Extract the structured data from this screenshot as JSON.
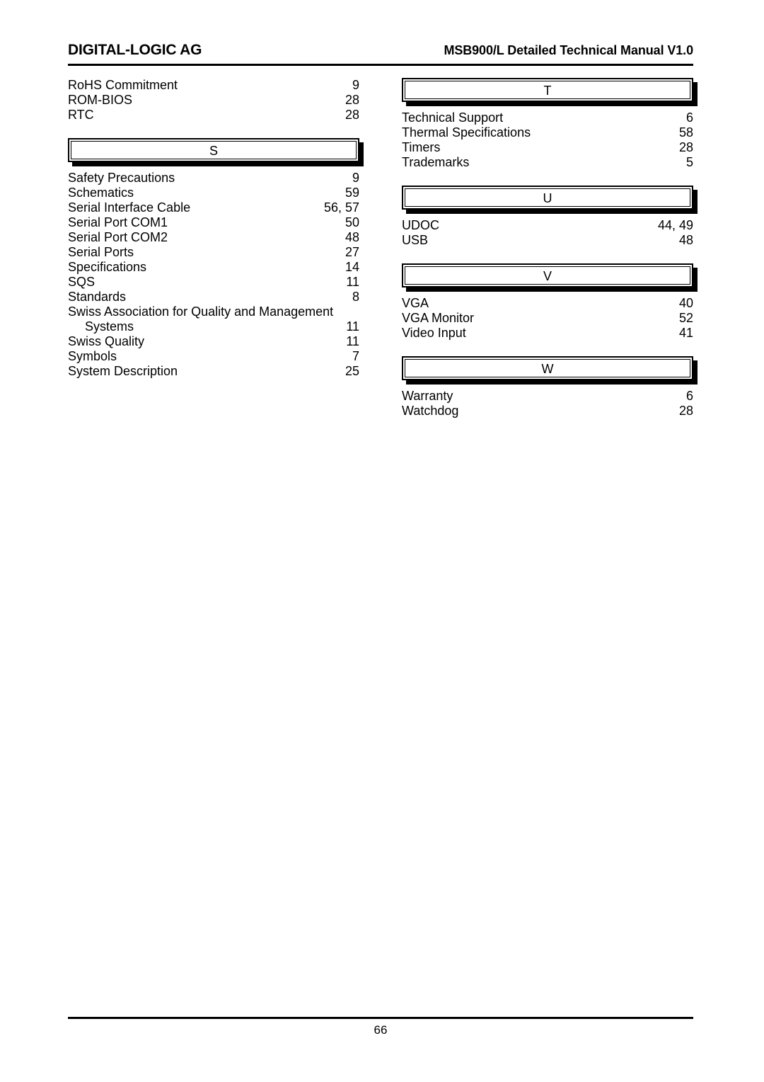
{
  "header": {
    "left_title": "DIGITAL-LOGIC AG",
    "right_title": "MSB900/L Detailed Technical Manual V1.0"
  },
  "footer": {
    "page_number": "66"
  },
  "columns": {
    "left": [
      {
        "kind": "entries",
        "entries": [
          {
            "term": "RoHS Commitment",
            "pages": "9",
            "indent": false
          },
          {
            "term": "ROM-BIOS",
            "pages": "28",
            "indent": false
          },
          {
            "term": "RTC",
            "pages": "28",
            "indent": false
          }
        ]
      },
      {
        "kind": "letter",
        "letter": "S"
      },
      {
        "kind": "entries",
        "entries": [
          {
            "term": "Safety Precautions",
            "pages": "9",
            "indent": false
          },
          {
            "term": "Schematics",
            "pages": "59",
            "indent": false
          },
          {
            "term": "Serial Interface Cable",
            "pages": "56, 57",
            "indent": false
          },
          {
            "term": "Serial Port COM1",
            "pages": "50",
            "indent": false
          },
          {
            "term": "Serial Port COM2",
            "pages": "48",
            "indent": false
          },
          {
            "term": "Serial Ports",
            "pages": "27",
            "indent": false
          },
          {
            "term": "Specifications",
            "pages": "14",
            "indent": false
          },
          {
            "term": "SQS",
            "pages": "11",
            "indent": false
          },
          {
            "term": "Standards",
            "pages": "8",
            "indent": false
          },
          {
            "term": "Swiss Association for Quality and Management",
            "pages": "",
            "indent": false,
            "wrap_head": true
          },
          {
            "term": "Systems",
            "pages": "11",
            "indent": true
          },
          {
            "term": "Swiss Quality",
            "pages": "11",
            "indent": false
          },
          {
            "term": "Symbols",
            "pages": "7",
            "indent": false
          },
          {
            "term": "System Description",
            "pages": "25",
            "indent": false
          }
        ]
      }
    ],
    "right": [
      {
        "kind": "letter",
        "letter": "T",
        "first": true
      },
      {
        "kind": "entries",
        "entries": [
          {
            "term": "Technical Support",
            "pages": "6",
            "indent": false
          },
          {
            "term": "Thermal Specifications",
            "pages": "58",
            "indent": false
          },
          {
            "term": "Timers",
            "pages": "28",
            "indent": false
          },
          {
            "term": "Trademarks",
            "pages": "5",
            "indent": false
          }
        ]
      },
      {
        "kind": "letter",
        "letter": "U"
      },
      {
        "kind": "entries",
        "entries": [
          {
            "term": "UDOC",
            "pages": "44, 49",
            "indent": false
          },
          {
            "term": "USB",
            "pages": "48",
            "indent": false
          }
        ]
      },
      {
        "kind": "letter",
        "letter": "V"
      },
      {
        "kind": "entries",
        "entries": [
          {
            "term": "VGA",
            "pages": "40",
            "indent": false
          },
          {
            "term": "VGA Monitor",
            "pages": "52",
            "indent": false
          },
          {
            "term": "Video Input",
            "pages": "41",
            "indent": false
          }
        ]
      },
      {
        "kind": "letter",
        "letter": "W"
      },
      {
        "kind": "entries",
        "entries": [
          {
            "term": "Warranty",
            "pages": "6",
            "indent": false
          },
          {
            "term": "Watchdog",
            "pages": "28",
            "indent": false
          }
        ]
      }
    ]
  }
}
